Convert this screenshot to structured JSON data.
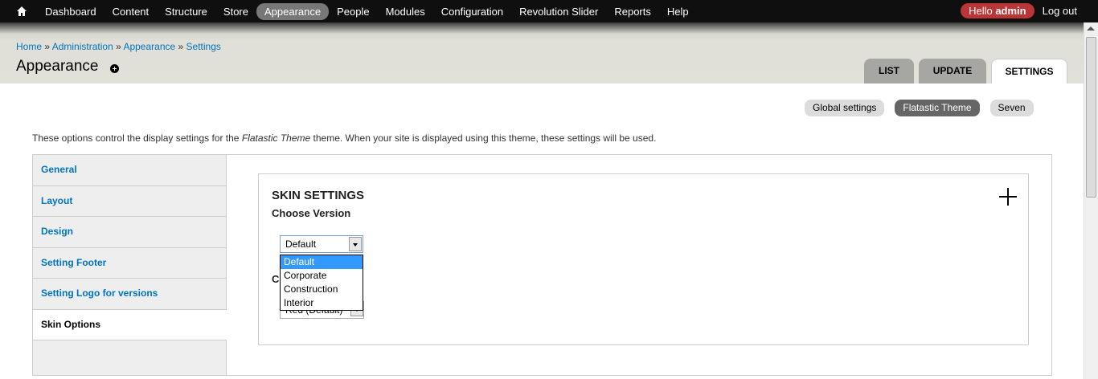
{
  "toolbar": {
    "items": [
      "Dashboard",
      "Content",
      "Structure",
      "Store",
      "Appearance",
      "People",
      "Modules",
      "Configuration",
      "Revolution Slider",
      "Reports",
      "Help"
    ],
    "active": "Appearance",
    "hello_prefix": "Hello",
    "hello_user": "admin",
    "logout": "Log out"
  },
  "breadcrumb": {
    "items": [
      "Home",
      "Administration",
      "Appearance",
      "Settings"
    ],
    "separator": "»"
  },
  "page": {
    "title": "Appearance",
    "tabs": [
      "LIST",
      "UPDATE",
      "SETTINGS"
    ],
    "active_tab": "SETTINGS"
  },
  "secondary_tabs": {
    "items": [
      "Global settings",
      "Flatastic Theme",
      "Seven"
    ],
    "active": "Flatastic Theme"
  },
  "intro": {
    "before": "These options control the display settings for the",
    "theme": "Flatastic Theme",
    "after": "theme. When your site is displayed using this theme, these settings will be used."
  },
  "vertical_tabs": {
    "items": [
      "General",
      "Layout",
      "Design",
      "Setting Footer",
      "Setting Logo for versions",
      "Skin Options"
    ],
    "active": "Skin Options"
  },
  "skin": {
    "fieldset_title": "SKIN SETTINGS",
    "choose_version_label": "Choose Version",
    "version_value": "Default",
    "version_options": [
      "Default",
      "Corporate",
      "Construction",
      "Interior"
    ],
    "second_label_visible": "C",
    "color_value": "Red (Default)"
  },
  "colors": {
    "toolbar_bg": "#0f0f0f",
    "link": "#0074bd",
    "hello_badge": "#b93536",
    "selected_option": "#3399ff"
  }
}
